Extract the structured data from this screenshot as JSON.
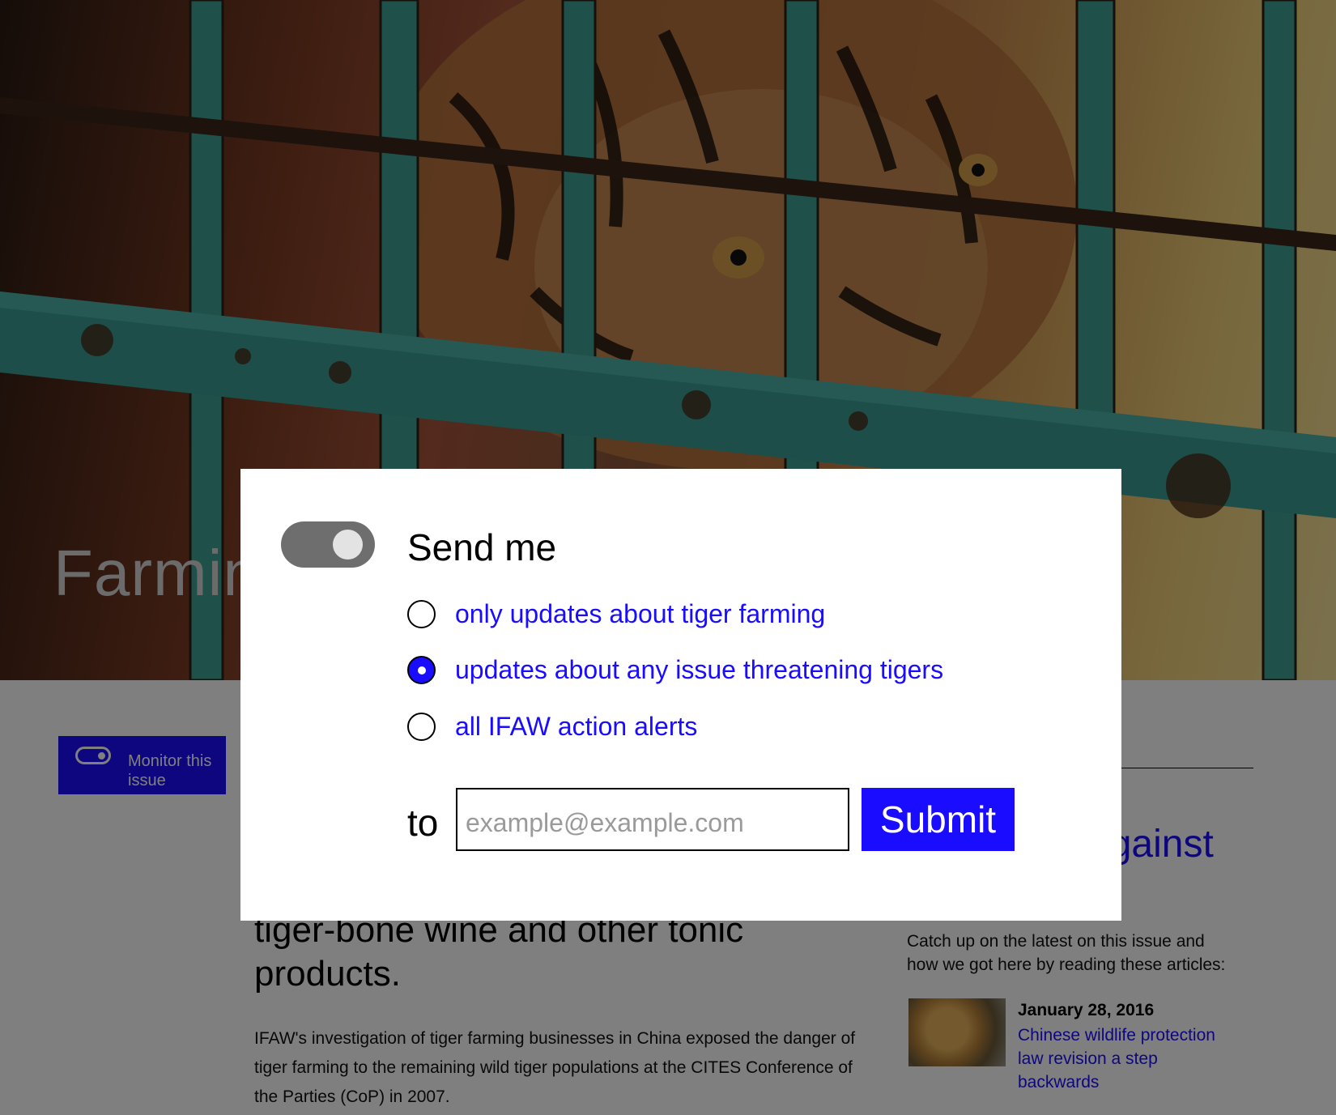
{
  "hero": {
    "title": "Farming"
  },
  "page": {
    "monitor_button_label": "Monitor this issue",
    "right_heading": "against",
    "right_intro": "Catch up on the latest on this issue and how we got here by reading these articles:",
    "article": {
      "date": "January 28, 2016",
      "title": "Chinese wildlife protection law revision a step backwards"
    },
    "main_heading": "tiger-bone wine and other tonic products.",
    "main_body": "IFAW's investigation of tiger farming businesses in China exposed the danger of tiger farming to the remaining wild tiger populations at the CITES Conference of the Parties (CoP) in 2007."
  },
  "modal": {
    "send_label": "Send me",
    "toggle_on": true,
    "options": [
      {
        "label": "only updates about tiger farming",
        "checked": false
      },
      {
        "label": "updates about any issue threatening tigers",
        "checked": true
      },
      {
        "label": "all IFAW action alerts",
        "checked": false
      }
    ],
    "to_label": "to",
    "email_placeholder": "example@example.com",
    "email_value": "",
    "submit_label": "Submit"
  },
  "colors": {
    "accent": "#1a0cff",
    "overlay": "rgba(0,0,0,0.5)",
    "toggle_track": "#6e6e6e"
  }
}
